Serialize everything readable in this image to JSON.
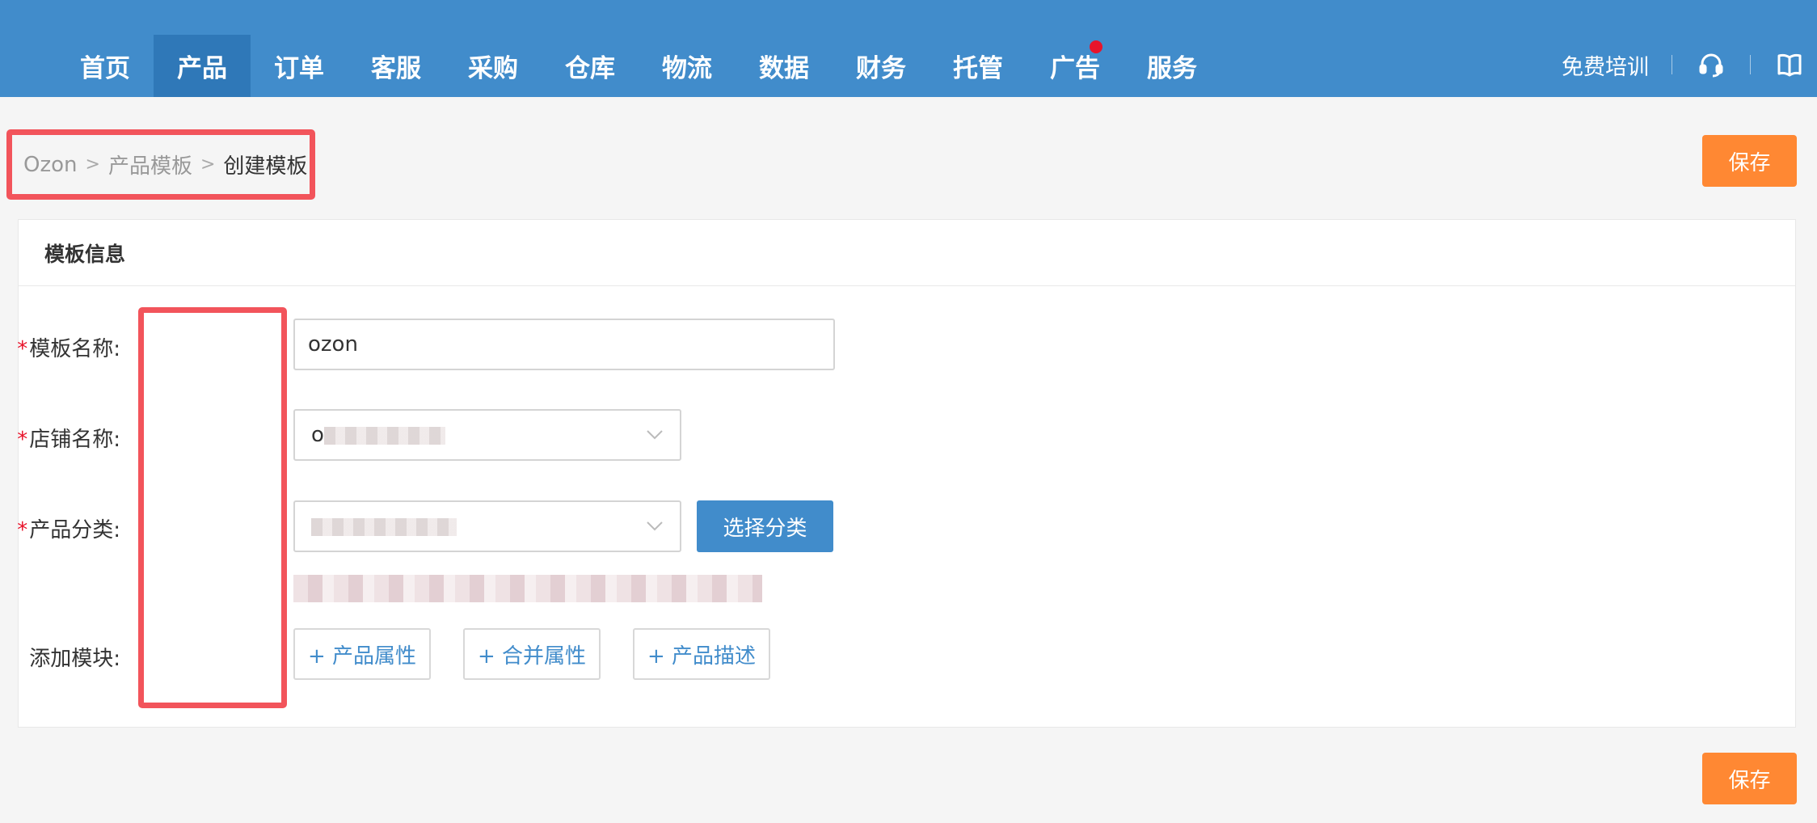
{
  "nav": {
    "items": [
      {
        "label": "首页"
      },
      {
        "label": "产品"
      },
      {
        "label": "订单"
      },
      {
        "label": "客服"
      },
      {
        "label": "采购"
      },
      {
        "label": "仓库"
      },
      {
        "label": "物流"
      },
      {
        "label": "数据"
      },
      {
        "label": "财务"
      },
      {
        "label": "托管"
      },
      {
        "label": "广告"
      },
      {
        "label": "服务"
      }
    ],
    "active": "产品",
    "right_link": "免费培训",
    "icons": [
      "headset-icon",
      "book-icon"
    ]
  },
  "breadcrumb": {
    "items": [
      "Ozon",
      "产品模板"
    ],
    "separator": ">",
    "current": "创建模板"
  },
  "actions": {
    "save_label": "保存"
  },
  "panel": {
    "title": "模板信息",
    "fields": {
      "template_name": {
        "required_mark": "*",
        "label": "模板名称:",
        "value": "ozon"
      },
      "store_name": {
        "required_mark": "*",
        "label": "店铺名称:",
        "value": "o"
      },
      "category": {
        "required_mark": "*",
        "label": "产品分类:",
        "value": "",
        "choose_button": "选择分类"
      },
      "modules": {
        "label": "添加模块:",
        "buttons": [
          "+ 产品属性",
          "+ 合并属性",
          "+ 产品描述"
        ]
      }
    }
  },
  "colors": {
    "brand": "#418ccb",
    "nav_active": "#2f78b8",
    "save": "#ff8833",
    "highlight": "#f2545b",
    "required": "#e8142b"
  }
}
